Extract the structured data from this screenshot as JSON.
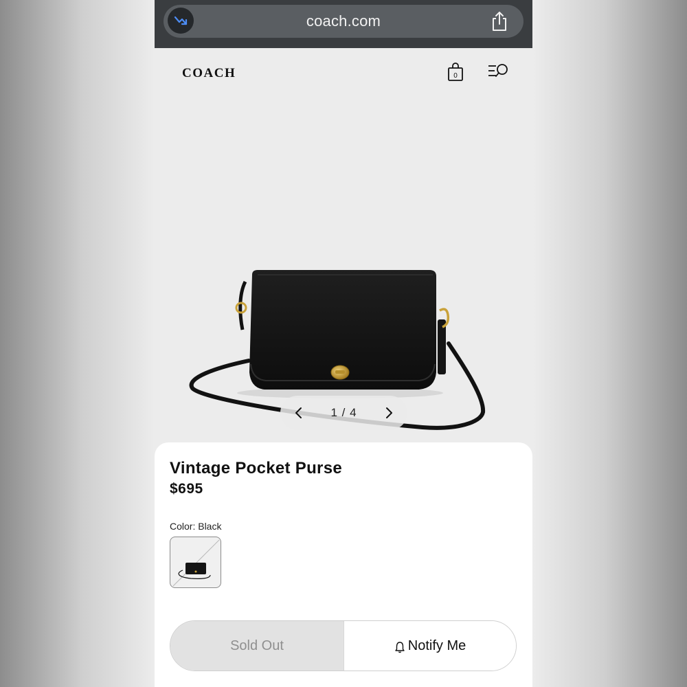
{
  "browser": {
    "url": "coach.com",
    "icons": {
      "site": "trend-down-icon",
      "share": "share-icon"
    }
  },
  "header": {
    "logo": "COACH",
    "bag_count": "0",
    "icons": {
      "bag": "shopping-bag-icon",
      "menu": "menu-search-icon"
    }
  },
  "gallery": {
    "counter": "1 / 4",
    "icons": {
      "prev": "chevron-left-icon",
      "next": "chevron-right-icon"
    }
  },
  "product": {
    "name": "Vintage Pocket Purse",
    "price": "$695",
    "color_label": "Color: Black"
  },
  "actions": {
    "sold_out": "Sold Out",
    "notify": "Notify Me",
    "icons": {
      "notify": "bell-icon"
    }
  },
  "colors": {
    "browser_bar": "#3a3d40",
    "url_pill": "#5a5e62",
    "bag": "#121212",
    "brass": "#c9a23a",
    "sold_out_bg": "#e2e2e2"
  }
}
